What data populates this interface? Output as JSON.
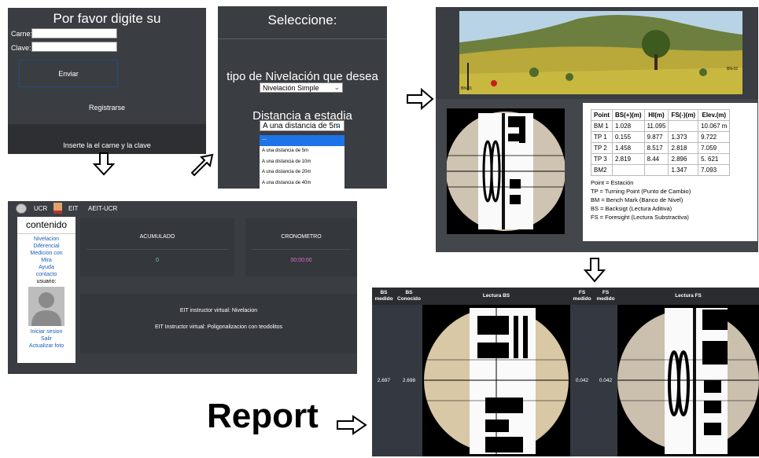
{
  "login": {
    "title": "Por favor digite su",
    "carne_label": "Carne:",
    "clave_label": "Clave:",
    "send_button": "Enviar",
    "register_link": "Registrarse",
    "footer_text": "Inserte la el carne y la clave"
  },
  "select": {
    "title": "Seleccione:",
    "leveling_question": "tipo de Nivelación que desea",
    "leveling_selected": "Nivelación Simple",
    "distance_question": "Distancia a estadia",
    "distance_selected": "A una distancia de 5m",
    "options": [
      "---",
      "A una distancia de 5m",
      "A una distancia de 10m",
      "A una distancia de 20m",
      "A una distancia de 40m"
    ]
  },
  "dashboard": {
    "topbar": {
      "ucr": "UCR",
      "eit": "EIT",
      "aeit": "AEIT-UCR"
    },
    "sidebar": {
      "heading": "contenido",
      "items": [
        "Nivelacion",
        "Diferencial",
        "Medicion con",
        "Mira",
        "Ayuda",
        "contacto"
      ],
      "user_label": "usuario:",
      "bottom_items": [
        "Iniciar sesion",
        "Salir",
        "Actualizar foto"
      ]
    },
    "acumulado_label": "ACUMULADO",
    "acumulado_value": "0",
    "cronometro_label": "CRONOMETRO",
    "cronometro_value": "00:00:00",
    "instructor_1": "EIT instructor virtual: Nivelacion",
    "instructor_2": "EIT Instructor virtual: Poligonalizacion con teodolitos"
  },
  "scene": {
    "marker_left": "BN-01",
    "marker_right": "BN-02"
  },
  "survey_table": {
    "headers": [
      "Point",
      "BS(+)(m)",
      "HI(m)",
      "FS(-)(m)",
      "Elev.(m)"
    ],
    "rows": [
      [
        "BM 1",
        "1.028",
        "11.095",
        "",
        "10.067 m"
      ],
      [
        "TP 1",
        "0.155",
        "9.877",
        "1.373",
        "9.722"
      ],
      [
        "TP 2",
        "1.458",
        "8.517",
        "2.818",
        "7.059"
      ],
      [
        "TP 3",
        "2.819",
        "8.44",
        "2.896",
        "5. 621"
      ],
      [
        "BM2",
        "",
        "",
        "1.347",
        "7.093"
      ]
    ],
    "legend": [
      "Point = Estación",
      "TP = Turning Point (Punto de Cambio)",
      "BM = Bench Mark (Banco de Nivel)",
      "BS = Backsigt (Lectura Aditiva)",
      "FS = Foresight (Lectura Substractiva)"
    ]
  },
  "report": {
    "label": "Report",
    "headers": {
      "bs_medido": "BS medido",
      "bs_conocido": "BS Conocido",
      "lectura_bs": "Lectura BS",
      "fs_medido": "FS medido",
      "fs_medido2": "FS medido",
      "lectura_fs": "Lectura FS"
    },
    "values": {
      "bs_medido": "2.697",
      "bs_conocido": "2.698",
      "fs_1": "0.042",
      "fs_2": "0.042"
    }
  },
  "colors": {
    "panel": "#3a3d42",
    "cyan": "#5fd3d3",
    "magenta": "#e070d0",
    "link": "#1a5fb4"
  }
}
